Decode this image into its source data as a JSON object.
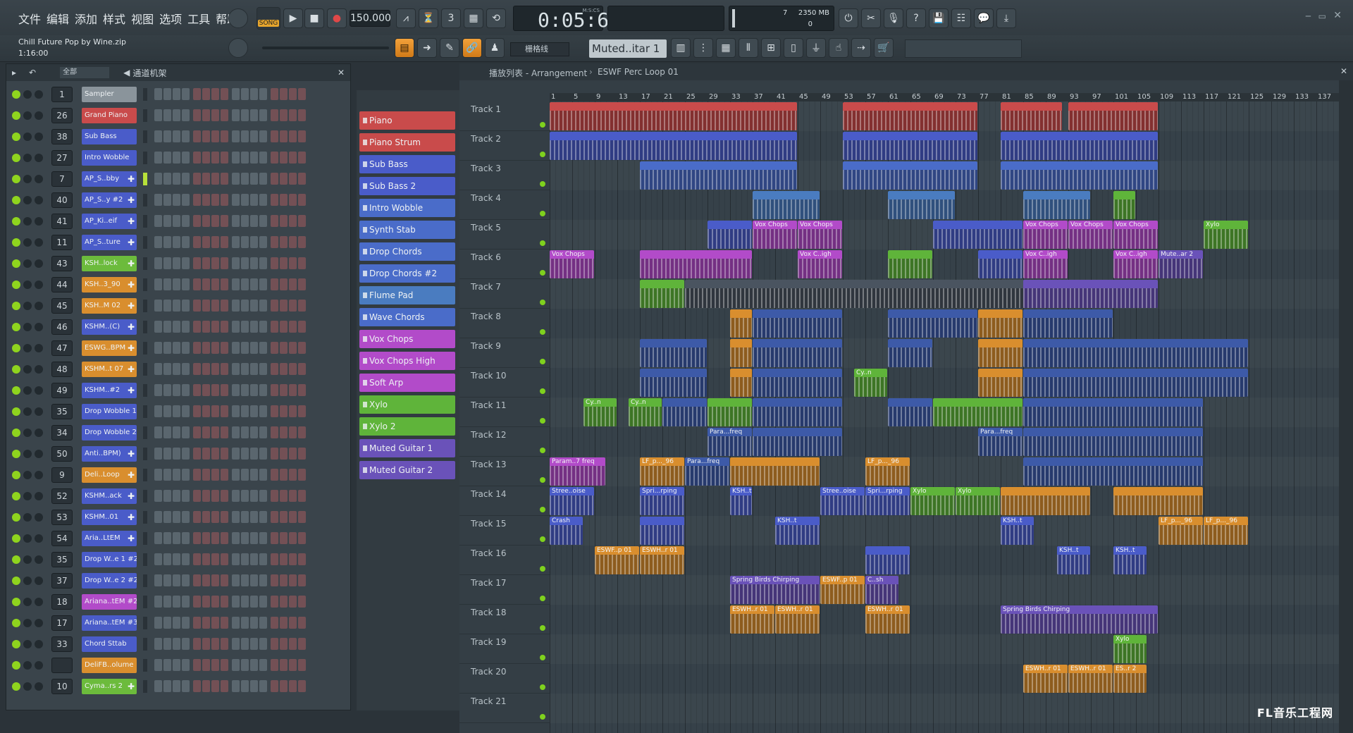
{
  "menu": [
    "文件",
    "编辑",
    "添加",
    "样式",
    "视图",
    "选项",
    "工具",
    "帮助"
  ],
  "transport": {
    "mode": "SONG",
    "tempo": "150.000",
    "time": "0:05:60",
    "time_unit": "M:S:CS",
    "cpu": "7",
    "memory": "2350 MB",
    "voices": "0"
  },
  "project": {
    "name": "Chill Future Pop by Wine.zip",
    "position": "1:16:00"
  },
  "toolbar": {
    "snap": "栅格线",
    "pattern": "Muted..itar 1"
  },
  "rack": {
    "filter": "全部",
    "title": "通道机架"
  },
  "channels": [
    {
      "num": "1",
      "name": "Sampler",
      "color": "#8a949b",
      "plus": false
    },
    {
      "num": "26",
      "name": "Grand Piano",
      "color": "#c94b4b",
      "plus": false
    },
    {
      "num": "38",
      "name": "Sub Bass",
      "color": "#4a5cc9",
      "plus": false
    },
    {
      "num": "27",
      "name": "Intro Wobble",
      "color": "#4a5cc9",
      "plus": false
    },
    {
      "num": "7",
      "name": "AP_S..bby",
      "color": "#4a5cc9",
      "plus": true
    },
    {
      "num": "40",
      "name": "AP_S..y #2",
      "color": "#4a5cc9",
      "plus": true
    },
    {
      "num": "41",
      "name": "AP_Ki..eif",
      "color": "#4a5cc9",
      "plus": true
    },
    {
      "num": "11",
      "name": "AP_S..ture",
      "color": "#4a5cc9",
      "plus": true
    },
    {
      "num": "43",
      "name": "KSH..lock",
      "color": "#6cbb3c",
      "plus": true
    },
    {
      "num": "44",
      "name": "KSH..3_90",
      "color": "#d98e2e",
      "plus": true
    },
    {
      "num": "45",
      "name": "KSH..M 02",
      "color": "#d98e2e",
      "plus": true
    },
    {
      "num": "46",
      "name": "KSHM..(C)",
      "color": "#4a5cc9",
      "plus": true
    },
    {
      "num": "47",
      "name": "ESWG..BPM",
      "color": "#d98e2e",
      "plus": true
    },
    {
      "num": "48",
      "name": "KSHM..t 07",
      "color": "#d98e2e",
      "plus": true
    },
    {
      "num": "49",
      "name": "KSHM..#2",
      "color": "#4a5cc9",
      "plus": true
    },
    {
      "num": "35",
      "name": "Drop Wobble 1",
      "color": "#4a5cc9",
      "plus": false
    },
    {
      "num": "34",
      "name": "Drop Wobble 2",
      "color": "#4a5cc9",
      "plus": false
    },
    {
      "num": "50",
      "name": "Anti..BPM)",
      "color": "#4a5cc9",
      "plus": true
    },
    {
      "num": "9",
      "name": "Deli..Loop",
      "color": "#d98e2e",
      "plus": true
    },
    {
      "num": "52",
      "name": "KSHM..ack",
      "color": "#4a5cc9",
      "plus": true
    },
    {
      "num": "53",
      "name": "KSHM..01",
      "color": "#4a5cc9",
      "plus": true
    },
    {
      "num": "54",
      "name": "Aria..LtEM",
      "color": "#4a5cc9",
      "plus": true
    },
    {
      "num": "35",
      "name": "Drop W..e 1 #2",
      "color": "#4a5cc9",
      "plus": false
    },
    {
      "num": "37",
      "name": "Drop W..e 2 #2",
      "color": "#4a5cc9",
      "plus": false
    },
    {
      "num": "18",
      "name": "Ariana..tEM #2",
      "color": "#b24bc9",
      "plus": false
    },
    {
      "num": "17",
      "name": "Ariana..tEM #3",
      "color": "#4a5cc9",
      "plus": false
    },
    {
      "num": "33",
      "name": "Chord Sttab",
      "color": "#4a5cc9",
      "plus": false
    },
    {
      "num": "",
      "name": "DeliFB..olume",
      "color": "#d98e2e",
      "plus": false
    },
    {
      "num": "10",
      "name": "Cyma..rs 2",
      "color": "#6cbb3c",
      "plus": true
    }
  ],
  "patterns": [
    {
      "name": "Piano",
      "color": "#c94b4b"
    },
    {
      "name": "Piano Strum",
      "color": "#c94b4b"
    },
    {
      "name": "Sub Bass",
      "color": "#4a5cc9"
    },
    {
      "name": "Sub Bass 2",
      "color": "#4a5cc9"
    },
    {
      "name": "Intro Wobble",
      "color": "#4a6cc9"
    },
    {
      "name": "Synth Stab",
      "color": "#4a6cc9"
    },
    {
      "name": "Drop Chords",
      "color": "#4a6cc9"
    },
    {
      "name": "Drop Chords  #2",
      "color": "#4a6cc9"
    },
    {
      "name": "Flume Pad",
      "color": "#4a7cc0"
    },
    {
      "name": "Wave Chords",
      "color": "#4a6cc9"
    },
    {
      "name": "Vox Chops",
      "color": "#b24bc9"
    },
    {
      "name": "Vox Chops High",
      "color": "#b24bc9"
    },
    {
      "name": "Soft Arp",
      "color": "#b24bc9"
    },
    {
      "name": "Xylo",
      "color": "#5fb43a"
    },
    {
      "name": "Xylo 2",
      "color": "#5fb43a"
    },
    {
      "name": "Muted Guitar 1",
      "color": "#6a52b9"
    },
    {
      "name": "Muted Guitar 2",
      "color": "#6a52b9"
    }
  ],
  "playlist": {
    "title": "播放列表 - Arrangement",
    "sep": "›",
    "current": "ESWF Perc Loop 01"
  },
  "ruler": [
    "1",
    "5",
    "9",
    "13",
    "17",
    "21",
    "25",
    "29",
    "33",
    "37",
    "41",
    "45",
    "49",
    "53",
    "57",
    "61",
    "65",
    "69",
    "73",
    "77",
    "81",
    "85",
    "89",
    "93",
    "97",
    "101",
    "105",
    "109",
    "113",
    "117",
    "121",
    "125",
    "129",
    "133",
    "137"
  ],
  "tracks": [
    "Track 1",
    "Track 2",
    "Track 3",
    "Track 4",
    "Track 5",
    "Track 6",
    "Track 7",
    "Track 8",
    "Track 9",
    "Track 10",
    "Track 11",
    "Track 12",
    "Track 13",
    "Track 14",
    "Track 15",
    "Track 16",
    "Track 17",
    "Track 18",
    "Track 19",
    "Track 20",
    "Track 21"
  ],
  "clips": [
    {
      "t": 0,
      "s": 0,
      "e": 44,
      "c": "#c94b4b",
      "l": "",
      "lab": true
    },
    {
      "t": 0,
      "s": 52,
      "e": 76,
      "c": "#c94b4b",
      "l": ""
    },
    {
      "t": 0,
      "s": 80,
      "e": 91,
      "c": "#c94b4b",
      "l": ""
    },
    {
      "t": 0,
      "s": 92,
      "e": 108,
      "c": "#c94b4b",
      "l": ""
    },
    {
      "t": 1,
      "s": 0,
      "e": 44,
      "c": "#4a5cc9",
      "l": ""
    },
    {
      "t": 1,
      "s": 52,
      "e": 76,
      "c": "#4a5cc9",
      "l": ""
    },
    {
      "t": 1,
      "s": 80,
      "e": 108,
      "c": "#4a5cc9",
      "l": ""
    },
    {
      "t": 2,
      "s": 16,
      "e": 44,
      "c": "#4a6cc9",
      "l": ""
    },
    {
      "t": 2,
      "s": 52,
      "e": 76,
      "c": "#4a6cc9",
      "l": ""
    },
    {
      "t": 2,
      "s": 80,
      "e": 108,
      "c": "#4a6cc9",
      "l": ""
    },
    {
      "t": 3,
      "s": 36,
      "e": 48,
      "c": "#4a7cc0",
      "l": ""
    },
    {
      "t": 3,
      "s": 60,
      "e": 72,
      "c": "#4a7cc0",
      "l": ""
    },
    {
      "t": 3,
      "s": 84,
      "e": 96,
      "c": "#4a7cc0",
      "l": ""
    },
    {
      "t": 3,
      "s": 100,
      "e": 104,
      "c": "#5fb43a",
      "l": ""
    },
    {
      "t": 4,
      "s": 28,
      "e": 36,
      "c": "#4a5cc9",
      "l": ""
    },
    {
      "t": 4,
      "s": 36,
      "e": 44,
      "c": "#b24bc9",
      "l": "Vox Chops"
    },
    {
      "t": 4,
      "s": 44,
      "e": 52,
      "c": "#b24bc9",
      "l": "Vox Chops"
    },
    {
      "t": 4,
      "s": 68,
      "e": 84,
      "c": "#4a5cc9",
      "l": ""
    },
    {
      "t": 4,
      "s": 84,
      "e": 92,
      "c": "#b24bc9",
      "l": "Vox Chops"
    },
    {
      "t": 4,
      "s": 92,
      "e": 100,
      "c": "#b24bc9",
      "l": "Vox Chops"
    },
    {
      "t": 4,
      "s": 100,
      "e": 108,
      "c": "#b24bc9",
      "l": "Vox Chops"
    },
    {
      "t": 4,
      "s": 116,
      "e": 124,
      "c": "#5fb43a",
      "l": "Xylo"
    },
    {
      "t": 5,
      "s": 0,
      "e": 8,
      "c": "#b24bc9",
      "l": "Vox Chops"
    },
    {
      "t": 5,
      "s": 16,
      "e": 36,
      "c": "#b24bc9",
      "l": ""
    },
    {
      "t": 5,
      "s": 44,
      "e": 52,
      "c": "#b24bc9",
      "l": "Vox C..igh"
    },
    {
      "t": 5,
      "s": 60,
      "e": 68,
      "c": "#5fb43a",
      "l": ""
    },
    {
      "t": 5,
      "s": 76,
      "e": 84,
      "c": "#4a5cc9",
      "l": ""
    },
    {
      "t": 5,
      "s": 84,
      "e": 92,
      "c": "#b24bc9",
      "l": "Vox C..igh"
    },
    {
      "t": 5,
      "s": 100,
      "e": 108,
      "c": "#b24bc9",
      "l": "Vox C..igh"
    },
    {
      "t": 5,
      "s": 108,
      "e": 116,
      "c": "#6a52b9",
      "l": "Mute..ar 2"
    },
    {
      "t": 6,
      "s": 16,
      "e": 24,
      "c": "#5fb43a",
      "l": ""
    },
    {
      "t": 6,
      "s": 24,
      "e": 100,
      "c": "#4a5460",
      "l": ""
    },
    {
      "t": 6,
      "s": 84,
      "e": 108,
      "c": "#6a52b9",
      "l": ""
    },
    {
      "t": 7,
      "s": 32,
      "e": 36,
      "c": "#d98e2e",
      "l": ""
    },
    {
      "t": 7,
      "s": 36,
      "e": 52,
      "c": "#3d5aa8",
      "l": ""
    },
    {
      "t": 7,
      "s": 60,
      "e": 76,
      "c": "#3d5aa8",
      "l": ""
    },
    {
      "t": 7,
      "s": 76,
      "e": 84,
      "c": "#d98e2e",
      "l": ""
    },
    {
      "t": 7,
      "s": 84,
      "e": 100,
      "c": "#3d5aa8",
      "l": ""
    },
    {
      "t": 8,
      "s": 16,
      "e": 28,
      "c": "#3d5aa8",
      "l": ""
    },
    {
      "t": 8,
      "s": 32,
      "e": 36,
      "c": "#d98e2e",
      "l": ""
    },
    {
      "t": 8,
      "s": 36,
      "e": 52,
      "c": "#3d5aa8",
      "l": ""
    },
    {
      "t": 8,
      "s": 60,
      "e": 68,
      "c": "#3d5aa8",
      "l": ""
    },
    {
      "t": 8,
      "s": 76,
      "e": 84,
      "c": "#d98e2e",
      "l": ""
    },
    {
      "t": 8,
      "s": 84,
      "e": 124,
      "c": "#3d5aa8",
      "l": ""
    },
    {
      "t": 9,
      "s": 16,
      "e": 28,
      "c": "#3d5aa8",
      "l": ""
    },
    {
      "t": 9,
      "s": 32,
      "e": 36,
      "c": "#d98e2e",
      "l": ""
    },
    {
      "t": 9,
      "s": 36,
      "e": 52,
      "c": "#3d5aa8",
      "l": ""
    },
    {
      "t": 9,
      "s": 54,
      "e": 60,
      "c": "#5fb43a",
      "l": "Cy..n"
    },
    {
      "t": 9,
      "s": 76,
      "e": 84,
      "c": "#d98e2e",
      "l": ""
    },
    {
      "t": 9,
      "s": 84,
      "e": 124,
      "c": "#3d5aa8",
      "l": ""
    },
    {
      "t": 10,
      "s": 6,
      "e": 12,
      "c": "#5fb43a",
      "l": "Cy..n"
    },
    {
      "t": 10,
      "s": 14,
      "e": 20,
      "c": "#5fb43a",
      "l": "Cy..n"
    },
    {
      "t": 10,
      "s": 20,
      "e": 28,
      "c": "#3d5aa8",
      "l": ""
    },
    {
      "t": 10,
      "s": 28,
      "e": 36,
      "c": "#5fb43a",
      "l": ""
    },
    {
      "t": 10,
      "s": 36,
      "e": 52,
      "c": "#3d5aa8",
      "l": ""
    },
    {
      "t": 10,
      "s": 60,
      "e": 68,
      "c": "#3d5aa8",
      "l": ""
    },
    {
      "t": 10,
      "s": 68,
      "e": 84,
      "c": "#5fb43a",
      "l": ""
    },
    {
      "t": 10,
      "s": 84,
      "e": 116,
      "c": "#3d5aa8",
      "l": ""
    },
    {
      "t": 11,
      "s": 28,
      "e": 36,
      "c": "#3d5aa8",
      "l": "Para...freq"
    },
    {
      "t": 11,
      "s": 36,
      "e": 52,
      "c": "#3d5aa8",
      "l": ""
    },
    {
      "t": 11,
      "s": 76,
      "e": 84,
      "c": "#3d5aa8",
      "l": "Para...freq"
    },
    {
      "t": 11,
      "s": 84,
      "e": 116,
      "c": "#3d5aa8",
      "l": ""
    },
    {
      "t": 12,
      "s": 0,
      "e": 10,
      "c": "#b24bc9",
      "l": "Param..7 freq"
    },
    {
      "t": 12,
      "s": 16,
      "e": 24,
      "c": "#d98e2e",
      "l": "LF_p..._96"
    },
    {
      "t": 12,
      "s": 24,
      "e": 32,
      "c": "#3d5aa8",
      "l": "Para...freq"
    },
    {
      "t": 12,
      "s": 32,
      "e": 48,
      "c": "#d98e2e",
      "l": ""
    },
    {
      "t": 12,
      "s": 56,
      "e": 64,
      "c": "#d98e2e",
      "l": "LF_p..._96"
    },
    {
      "t": 12,
      "s": 84,
      "e": 116,
      "c": "#3d5aa8",
      "l": ""
    },
    {
      "t": 13,
      "s": 0,
      "e": 8,
      "c": "#4a5cc9",
      "l": "Stree..oise"
    },
    {
      "t": 13,
      "s": 16,
      "e": 24,
      "c": "#4a5cc9",
      "l": "Spri...rping"
    },
    {
      "t": 13,
      "s": 32,
      "e": 36,
      "c": "#4a5cc9",
      "l": "KSH..t"
    },
    {
      "t": 13,
      "s": 48,
      "e": 56,
      "c": "#4a5cc9",
      "l": "Stree..oise"
    },
    {
      "t": 13,
      "s": 56,
      "e": 64,
      "c": "#4a5cc9",
      "l": "Spri...rping"
    },
    {
      "t": 13,
      "s": 64,
      "e": 72,
      "c": "#5fb43a",
      "l": "Xylo"
    },
    {
      "t": 13,
      "s": 72,
      "e": 80,
      "c": "#5fb43a",
      "l": "Xylo"
    },
    {
      "t": 13,
      "s": 80,
      "e": 96,
      "c": "#d98e2e",
      "l": ""
    },
    {
      "t": 13,
      "s": 100,
      "e": 116,
      "c": "#d98e2e",
      "l": ""
    },
    {
      "t": 14,
      "s": 0,
      "e": 6,
      "c": "#4a5cc9",
      "l": "Crash"
    },
    {
      "t": 14,
      "s": 16,
      "e": 24,
      "c": "#4a5cc9",
      "l": ""
    },
    {
      "t": 14,
      "s": 40,
      "e": 48,
      "c": "#4a5cc9",
      "l": "KSH..t"
    },
    {
      "t": 14,
      "s": 80,
      "e": 86,
      "c": "#4a5cc9",
      "l": "KSH..t"
    },
    {
      "t": 14,
      "s": 108,
      "e": 116,
      "c": "#d98e2e",
      "l": "LF_p..._96"
    },
    {
      "t": 14,
      "s": 116,
      "e": 124,
      "c": "#d98e2e",
      "l": "LF_p..._96"
    },
    {
      "t": 15,
      "s": 8,
      "e": 16,
      "c": "#d98e2e",
      "l": "ESWF..p 01"
    },
    {
      "t": 15,
      "s": 16,
      "e": 24,
      "c": "#d98e2e",
      "l": "ESWH..r 01"
    },
    {
      "t": 15,
      "s": 56,
      "e": 64,
      "c": "#4a5cc9",
      "l": ""
    },
    {
      "t": 15,
      "s": 90,
      "e": 96,
      "c": "#4a5cc9",
      "l": "KSH..t"
    },
    {
      "t": 15,
      "s": 100,
      "e": 106,
      "c": "#4a5cc9",
      "l": "KSH..t"
    },
    {
      "t": 16,
      "s": 32,
      "e": 48,
      "c": "#6a52b9",
      "l": "Spring Birds Chirping"
    },
    {
      "t": 16,
      "s": 48,
      "e": 56,
      "c": "#d98e2e",
      "l": "ESWF..p 01"
    },
    {
      "t": 16,
      "s": 56,
      "e": 62,
      "c": "#6a52b9",
      "l": "C..sh"
    },
    {
      "t": 17,
      "s": 32,
      "e": 40,
      "c": "#d98e2e",
      "l": "ESWH..r 01"
    },
    {
      "t": 17,
      "s": 40,
      "e": 48,
      "c": "#d98e2e",
      "l": "ESWH..r 01"
    },
    {
      "t": 17,
      "s": 56,
      "e": 64,
      "c": "#d98e2e",
      "l": "ESWH..r 01"
    },
    {
      "t": 17,
      "s": 80,
      "e": 108,
      "c": "#6a52b9",
      "l": "Spring Birds Chirping"
    },
    {
      "t": 18,
      "s": 100,
      "e": 106,
      "c": "#5fb43a",
      "l": "Xylo"
    },
    {
      "t": 19,
      "s": 84,
      "e": 92,
      "c": "#d98e2e",
      "l": "ESWH..r 01"
    },
    {
      "t": 19,
      "s": 92,
      "e": 100,
      "c": "#d98e2e",
      "l": "ESWH..r 01"
    },
    {
      "t": 19,
      "s": 100,
      "e": 106,
      "c": "#d98e2e",
      "l": "ES..r 2"
    }
  ],
  "watermark": "FL音乐工程网"
}
